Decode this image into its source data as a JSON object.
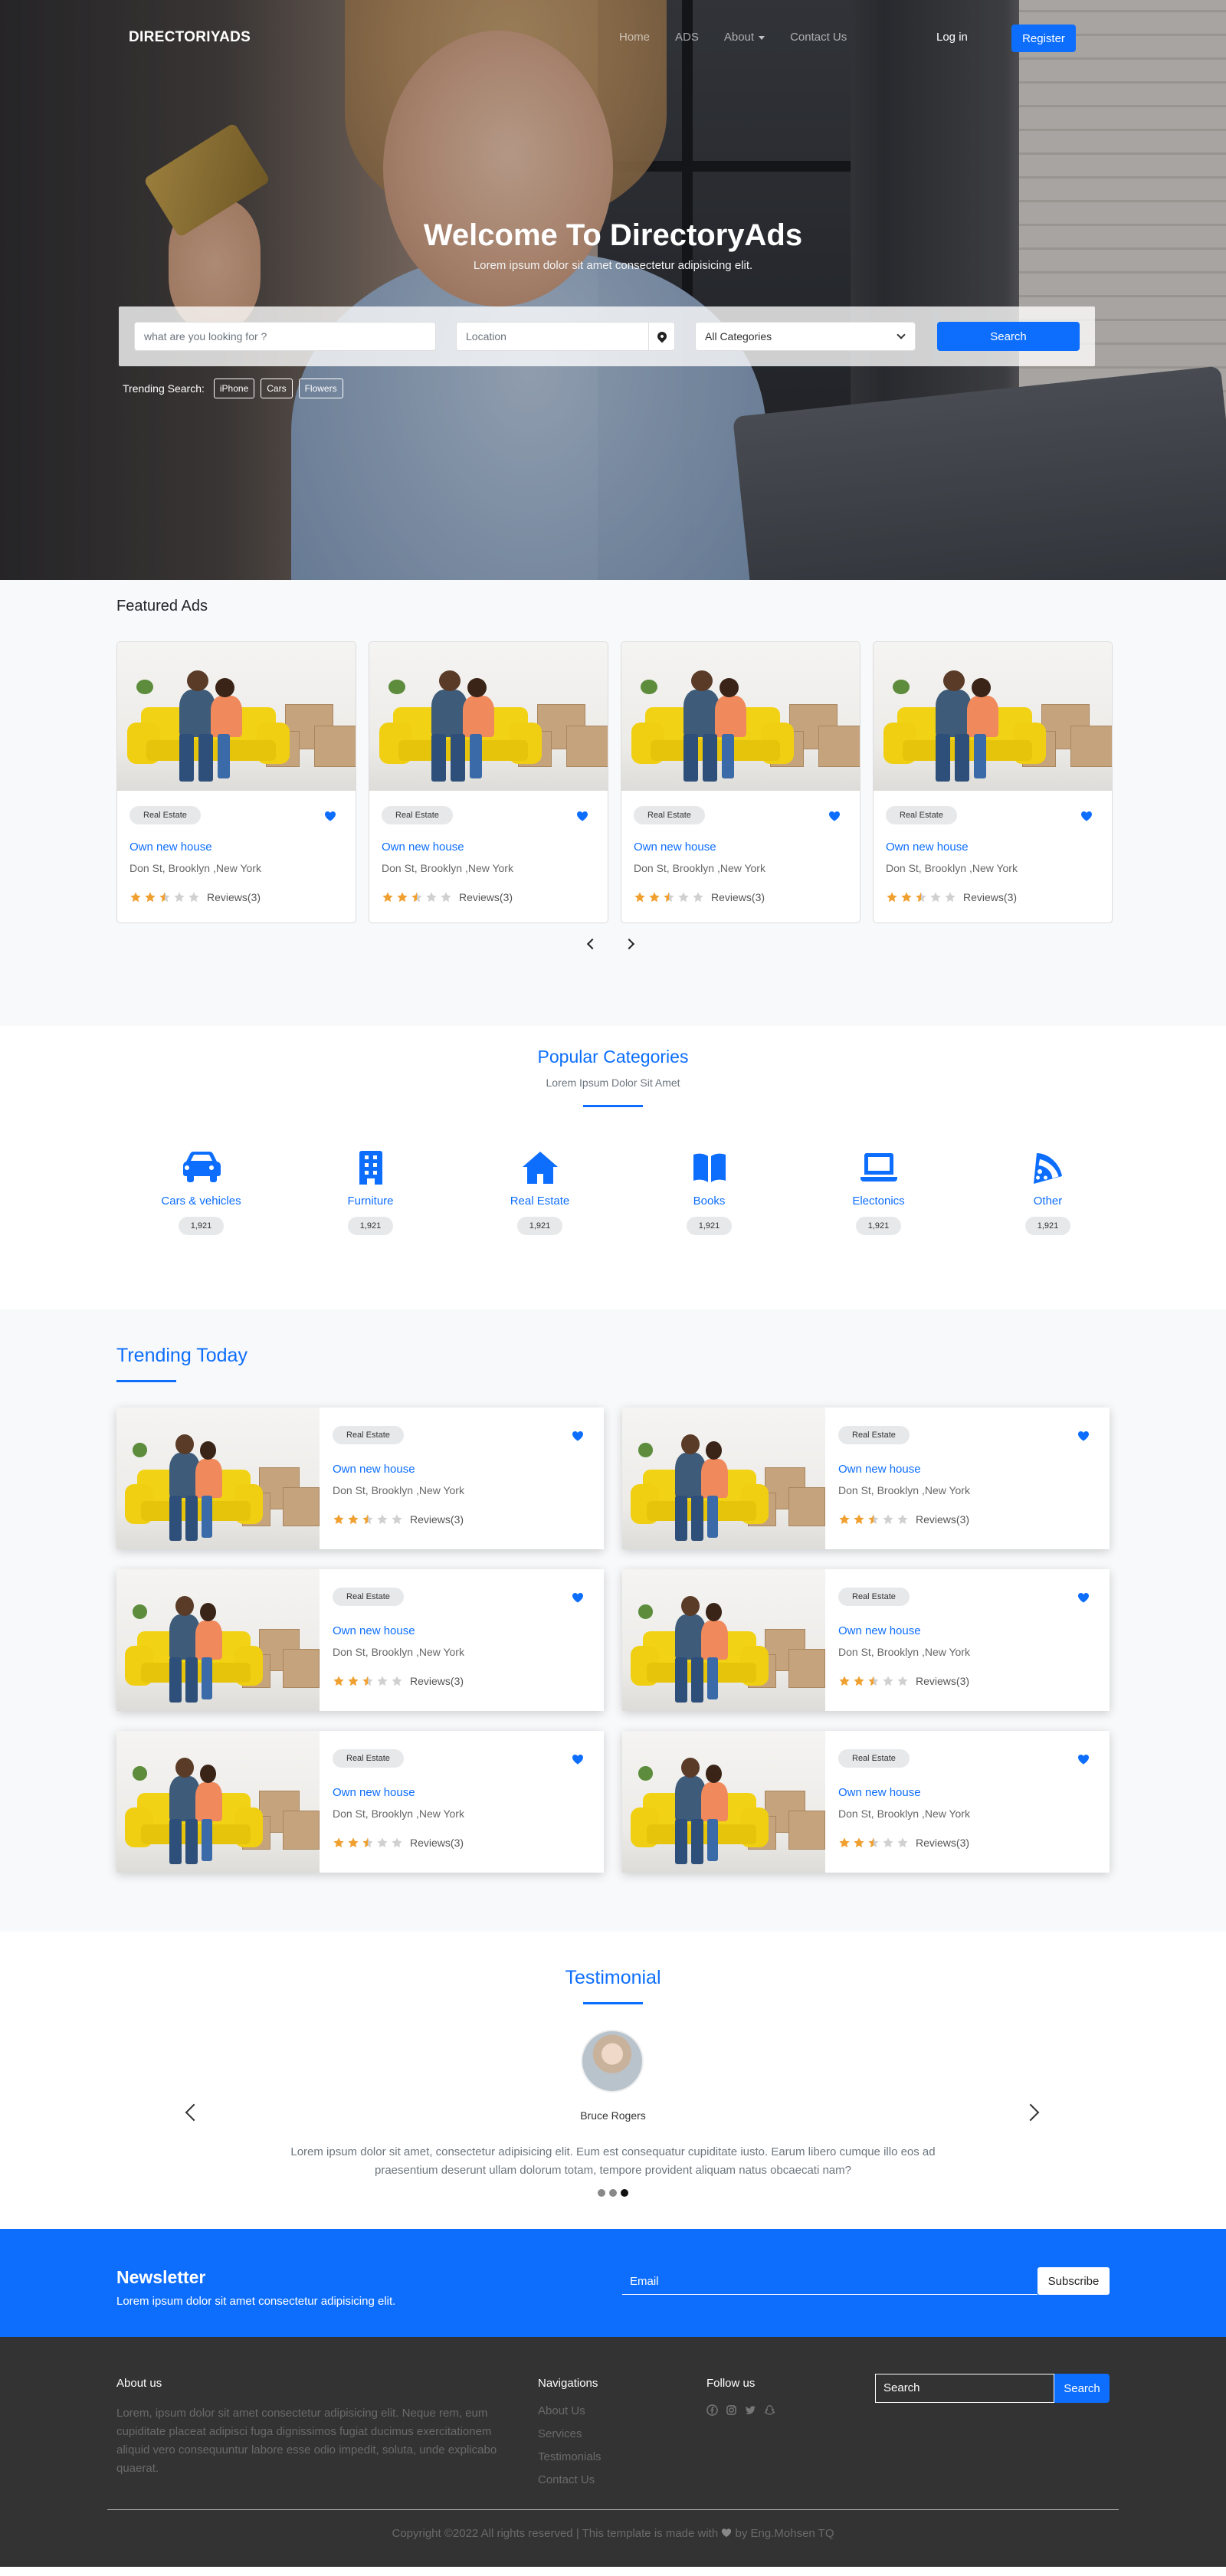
{
  "nav": {
    "brand": "DIRECTORIYADS",
    "menu": [
      "Home",
      "ADS",
      "About",
      "Contact Us"
    ],
    "login": "Log in",
    "register": "Register"
  },
  "hero": {
    "title": "Welcome To DirectoryAds",
    "subtitle": "Lorem ipsum dolor sit amet consectetur adipisicing elit.",
    "search_placeholder": "what are you looking for ?",
    "location_placeholder": "Location",
    "category_selected": "All Categories",
    "search_button": "Search",
    "trending_label": "Trending Search:",
    "trending_chips": [
      "iPhone",
      "Cars",
      "Flowers"
    ]
  },
  "featured": {
    "heading": "Featured Ads",
    "cards": [
      {
        "badge": "Real Estate",
        "title": "Own new house",
        "address": "Don St, Brooklyn ,New York",
        "rating": 2.5,
        "reviews": "Reviews(3)"
      },
      {
        "badge": "Real Estate",
        "title": "Own new house",
        "address": "Don St, Brooklyn ,New York",
        "rating": 2.5,
        "reviews": "Reviews(3)"
      },
      {
        "badge": "Real Estate",
        "title": "Own new house",
        "address": "Don St, Brooklyn ,New York",
        "rating": 2.5,
        "reviews": "Reviews(3)"
      },
      {
        "badge": "Real Estate",
        "title": "Own new house",
        "address": "Don St, Brooklyn ,New York",
        "rating": 2.5,
        "reviews": "Reviews(3)"
      }
    ]
  },
  "popular": {
    "heading": "Popular Categories",
    "subheading": "Lorem Ipsum Dolor Sit Amet",
    "categories": [
      {
        "name": "Cars & vehicles",
        "count": "1,921",
        "icon": "car-icon"
      },
      {
        "name": "Furniture",
        "count": "1,921",
        "icon": "building-icon"
      },
      {
        "name": "Real Estate",
        "count": "1,921",
        "icon": "house-icon"
      },
      {
        "name": "Books",
        "count": "1,921",
        "icon": "book-icon"
      },
      {
        "name": "Electonics",
        "count": "1,921",
        "icon": "laptop-icon"
      },
      {
        "name": "Other",
        "count": "1,921",
        "icon": "pizza-icon"
      }
    ]
  },
  "trending": {
    "heading": "Trending Today",
    "cards": [
      {
        "badge": "Real Estate",
        "title": "Own new house",
        "address": "Don St, Brooklyn ,New York",
        "rating": 2.5,
        "reviews": "Reviews(3)"
      },
      {
        "badge": "Real Estate",
        "title": "Own new house",
        "address": "Don St, Brooklyn ,New York",
        "rating": 2.5,
        "reviews": "Reviews(3)"
      },
      {
        "badge": "Real Estate",
        "title": "Own new house",
        "address": "Don St, Brooklyn ,New York",
        "rating": 2.5,
        "reviews": "Reviews(3)"
      },
      {
        "badge": "Real Estate",
        "title": "Own new house",
        "address": "Don St, Brooklyn ,New York",
        "rating": 2.5,
        "reviews": "Reviews(3)"
      },
      {
        "badge": "Real Estate",
        "title": "Own new house",
        "address": "Don St, Brooklyn ,New York",
        "rating": 2.5,
        "reviews": "Reviews(3)"
      },
      {
        "badge": "Real Estate",
        "title": "Own new house",
        "address": "Don St, Brooklyn ,New York",
        "rating": 2.5,
        "reviews": "Reviews(3)"
      }
    ]
  },
  "testimonial": {
    "heading": "Testimonial",
    "name": "Bruce Rogers",
    "quote": "Lorem ipsum dolor sit amet, consectetur adipisicing elit. Eum est consequatur cupiditate iusto. Earum libero cumque illo eos ad praesentium deserunt ullam dolorum totam, tempore provident aliquam natus obcaecati nam?",
    "active_slide": 3,
    "slides": 3
  },
  "newsletter": {
    "heading": "Newsletter",
    "text": "Lorem ipsum dolor sit amet consectetur adipisicing elit.",
    "email_placeholder": "Email",
    "button": "Subscribe"
  },
  "footer": {
    "about_heading": "About us",
    "about_text": "Lorem, ipsum dolor sit amet consectetur adipisicing elit. Neque rem, eum cupiditate placeat adipisci fuga dignissimos fugiat ducimus exercitationem aliquid vero consequuntur labore esse odio impedit, soluta, unde explicabo quaerat.",
    "nav_heading": "Navigations",
    "nav_links": [
      "About Us",
      "Services",
      "Testimonials",
      "Contact Us"
    ],
    "follow_heading": "Follow us",
    "social_icons": [
      "facebook-icon",
      "instagram-icon",
      "twitter-icon",
      "snapchat-icon"
    ],
    "search_placeholder": "Search",
    "search_button": "Search",
    "copyright_left": "Copyright ©2022 All rights reserved | This template is made with",
    "copyright_right": "by Eng.Mohsen TQ"
  },
  "colors": {
    "accent": "#0d6efd",
    "star": "#f0a030",
    "footer_bg": "#333333"
  }
}
